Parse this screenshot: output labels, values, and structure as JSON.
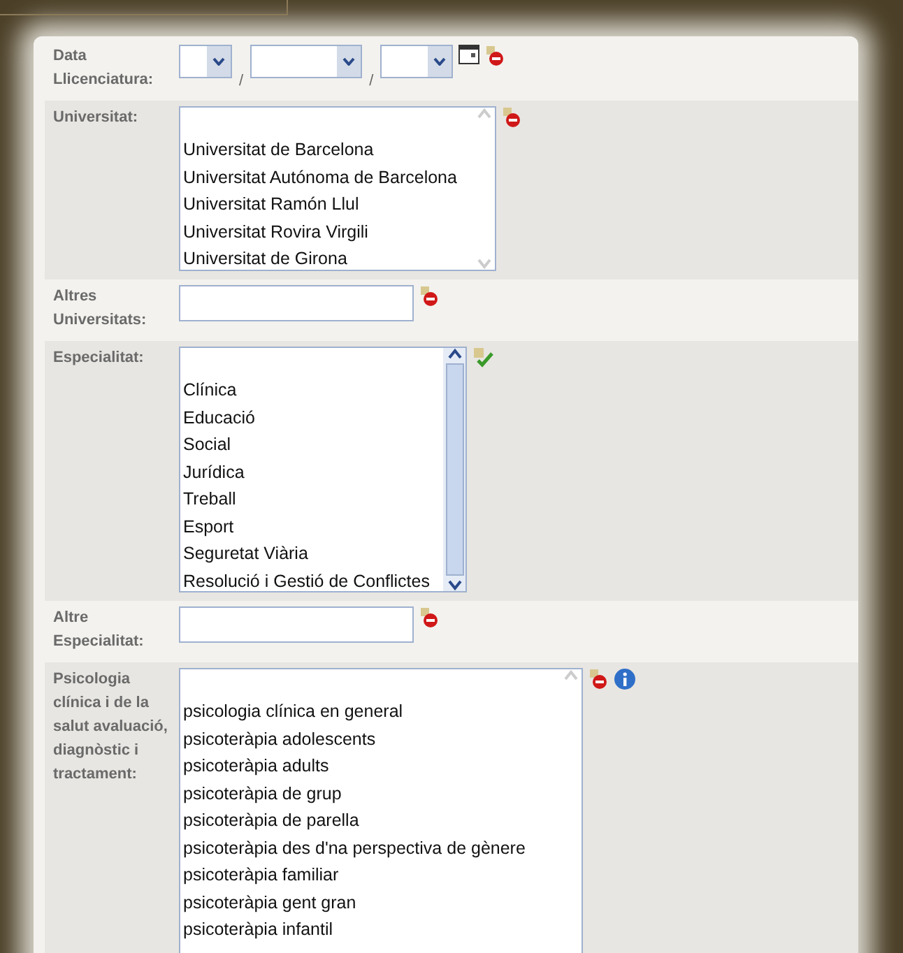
{
  "form": {
    "fields": [
      {
        "kind": "date",
        "label": "Data Llicenciatura:",
        "parts": [
          {
            "kind": "select"
          },
          {
            "kind": "separator",
            "text": "/"
          },
          {
            "kind": "select"
          },
          {
            "kind": "separator",
            "text": "/"
          },
          {
            "kind": "select"
          }
        ],
        "actions": [
          {
            "kind": "calendar"
          },
          {
            "kind": "remove"
          }
        ]
      },
      {
        "kind": "listbox",
        "label": "Universitat:",
        "scroll_enabled": false,
        "options": [
          "Universitat de Barcelona",
          "Universitat Autónoma de Barcelona",
          "Universitat Ramón Llul",
          "Universitat Rovira Virgili",
          "Universitat de Girona"
        ],
        "actions": [
          {
            "kind": "remove"
          }
        ]
      },
      {
        "kind": "text",
        "label": "Altres Universitats:",
        "actions": [
          {
            "kind": "remove"
          }
        ]
      },
      {
        "kind": "listbox",
        "label": "Especialitat:",
        "scroll_enabled": true,
        "options": [
          "Clínica",
          "Educació",
          "Social",
          "Jurídica",
          "Treball",
          "Esport",
          "Seguretat Viària",
          "Resolució i Gestió de Conflictes"
        ],
        "actions": [
          {
            "kind": "accept"
          }
        ]
      },
      {
        "kind": "text",
        "label": "Altre Especialitat:",
        "actions": [
          {
            "kind": "remove"
          }
        ]
      },
      {
        "kind": "listbox",
        "label": "Psicologia clínica i de la salut avaluació, diagnòstic i tractament:",
        "scroll_enabled": false,
        "options": [
          "psicologia clínica en general",
          "psicoteràpia adolescents",
          "psicoteràpia adults",
          "psicoteràpia de grup",
          "psicoteràpia de parella",
          "psicoteràpia des d'na perspectiva de gènere",
          "psicoteràpia familiar",
          "psicoteràpia gent gran",
          "psicoteràpia infantil"
        ],
        "actions": [
          {
            "kind": "remove"
          },
          {
            "kind": "info"
          }
        ]
      }
    ]
  }
}
